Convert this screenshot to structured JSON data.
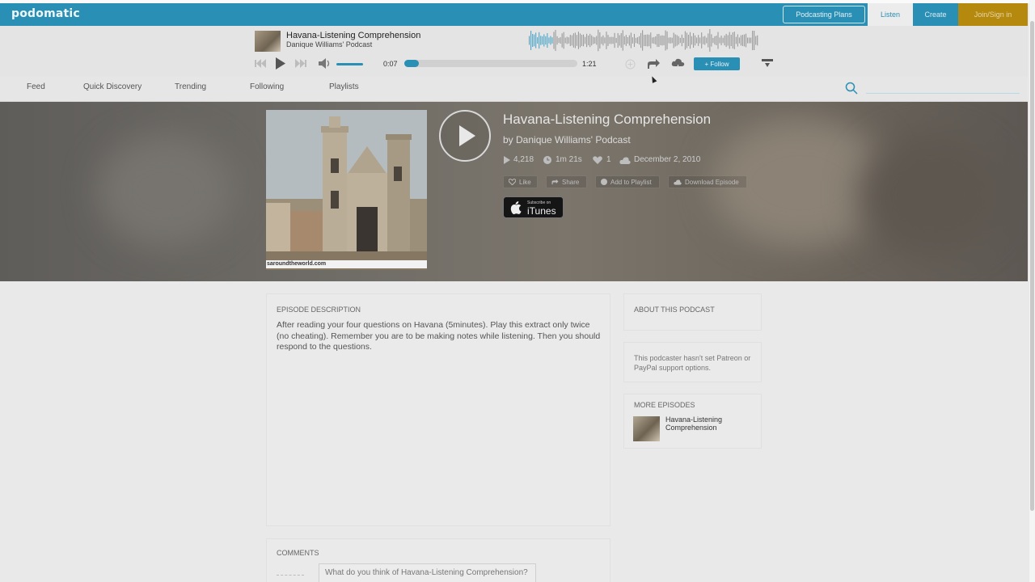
{
  "header": {
    "logo": "podomatic",
    "plans_label": "Podcasting Plans",
    "listen_label": "Listen",
    "create_label": "Create",
    "join_label": "Join/Sign in"
  },
  "player": {
    "title": "Havana-Listening Comprehension",
    "podcast": "Danique Williams' Podcast",
    "elapsed": "0:07",
    "duration": "1:21",
    "progress_fraction": 0.086,
    "follow_label": "+ Follow"
  },
  "subnav": {
    "items": [
      "Feed",
      "Quick Discovery",
      "Trending",
      "Following",
      "Playlists"
    ],
    "search_placeholder": ""
  },
  "episode": {
    "title": "Havana-Listening Comprehension",
    "byline": "by Danique Williams' Podcast",
    "plays": "4,218",
    "length": "1m 21s",
    "likes": "1",
    "date": "December 2, 2010",
    "cover_caption": "saroundtheworld.com",
    "actions": {
      "like": "Like",
      "share": "Share",
      "playlist": "Add to Playlist",
      "download": "Download Episode"
    },
    "itunes_small": "Subscribe on",
    "itunes_big": "iTunes"
  },
  "description": {
    "heading": "EPISODE DESCRIPTION",
    "text": "After reading your four questions on Havana (5minutes). Play this extract only twice (no cheating). Remember you are to be making notes while listening. Then you should respond to the questions."
  },
  "about": {
    "heading": "ABOUT THIS PODCAST"
  },
  "support": {
    "text": "This podcaster hasn't set Patreon or PayPal support options."
  },
  "more_episodes": {
    "heading": "MORE EPISODES",
    "items": [
      {
        "title": "Havana-Listening Comprehension"
      }
    ]
  },
  "comments": {
    "heading": "COMMENTS",
    "placeholder": "What do you think of Havana-Listening Comprehension?"
  },
  "colors": {
    "brand": "#2a8fb4",
    "join": "#b5890e"
  }
}
